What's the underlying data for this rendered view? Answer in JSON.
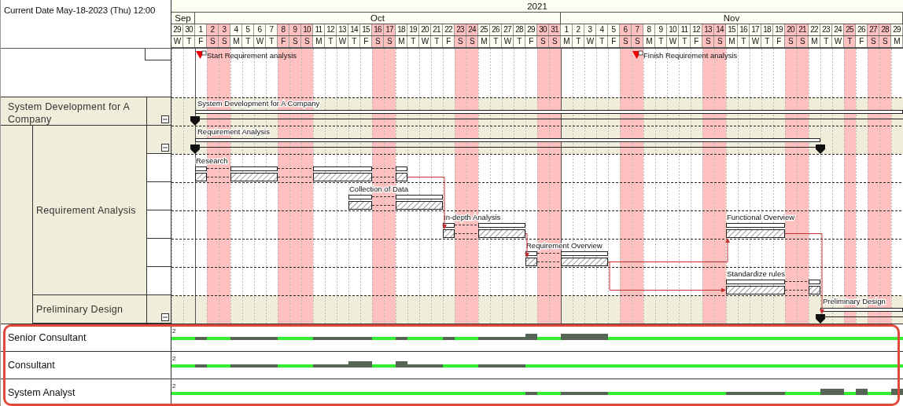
{
  "header": {
    "current_date": "Current Date May-18-2023 (Thu) 12:00"
  },
  "timeline": {
    "year": "2021",
    "months": [
      {
        "label": "Sep",
        "days": [
          {
            "date": "29",
            "weekday": "W",
            "holiday": false
          },
          {
            "date": "30",
            "weekday": "T",
            "holiday": false
          }
        ]
      },
      {
        "label": "Oct",
        "days": [
          {
            "date": "1",
            "weekday": "F",
            "holiday": false
          },
          {
            "date": "2",
            "weekday": "S",
            "holiday": true
          },
          {
            "date": "3",
            "weekday": "S",
            "holiday": true
          },
          {
            "date": "4",
            "weekday": "M",
            "holiday": false
          },
          {
            "date": "5",
            "weekday": "T",
            "holiday": false
          },
          {
            "date": "6",
            "weekday": "W",
            "holiday": false
          },
          {
            "date": "7",
            "weekday": "T",
            "holiday": false
          },
          {
            "date": "8",
            "weekday": "F",
            "holiday": true
          },
          {
            "date": "9",
            "weekday": "S",
            "holiday": true
          },
          {
            "date": "10",
            "weekday": "S",
            "holiday": true
          },
          {
            "date": "11",
            "weekday": "M",
            "holiday": false
          },
          {
            "date": "12",
            "weekday": "T",
            "holiday": false
          },
          {
            "date": "13",
            "weekday": "W",
            "holiday": false
          },
          {
            "date": "14",
            "weekday": "T",
            "holiday": false
          },
          {
            "date": "15",
            "weekday": "F",
            "holiday": false
          },
          {
            "date": "16",
            "weekday": "S",
            "holiday": true
          },
          {
            "date": "17",
            "weekday": "S",
            "holiday": true
          },
          {
            "date": "18",
            "weekday": "M",
            "holiday": false
          },
          {
            "date": "19",
            "weekday": "T",
            "holiday": false
          },
          {
            "date": "20",
            "weekday": "W",
            "holiday": false
          },
          {
            "date": "21",
            "weekday": "T",
            "holiday": false
          },
          {
            "date": "22",
            "weekday": "F",
            "holiday": false
          },
          {
            "date": "23",
            "weekday": "S",
            "holiday": true
          },
          {
            "date": "24",
            "weekday": "S",
            "holiday": true
          },
          {
            "date": "25",
            "weekday": "M",
            "holiday": false
          },
          {
            "date": "26",
            "weekday": "T",
            "holiday": false
          },
          {
            "date": "27",
            "weekday": "W",
            "holiday": false
          },
          {
            "date": "28",
            "weekday": "T",
            "holiday": false
          },
          {
            "date": "29",
            "weekday": "F",
            "holiday": false
          },
          {
            "date": "30",
            "weekday": "S",
            "holiday": true
          },
          {
            "date": "31",
            "weekday": "S",
            "holiday": true
          }
        ]
      },
      {
        "label": "Nov",
        "days": [
          {
            "date": "1",
            "weekday": "M",
            "holiday": false
          },
          {
            "date": "2",
            "weekday": "T",
            "holiday": false
          },
          {
            "date": "3",
            "weekday": "W",
            "holiday": false
          },
          {
            "date": "4",
            "weekday": "T",
            "holiday": false
          },
          {
            "date": "5",
            "weekday": "F",
            "holiday": false
          },
          {
            "date": "6",
            "weekday": "S",
            "holiday": true
          },
          {
            "date": "7",
            "weekday": "S",
            "holiday": true
          },
          {
            "date": "8",
            "weekday": "M",
            "holiday": false
          },
          {
            "date": "9",
            "weekday": "T",
            "holiday": false
          },
          {
            "date": "10",
            "weekday": "W",
            "holiday": false
          },
          {
            "date": "11",
            "weekday": "T",
            "holiday": false
          },
          {
            "date": "12",
            "weekday": "F",
            "holiday": false
          },
          {
            "date": "13",
            "weekday": "S",
            "holiday": true
          },
          {
            "date": "14",
            "weekday": "S",
            "holiday": true
          },
          {
            "date": "15",
            "weekday": "M",
            "holiday": false
          },
          {
            "date": "16",
            "weekday": "T",
            "holiday": false
          },
          {
            "date": "17",
            "weekday": "W",
            "holiday": false
          },
          {
            "date": "18",
            "weekday": "T",
            "holiday": false
          },
          {
            "date": "19",
            "weekday": "F",
            "holiday": false
          },
          {
            "date": "20",
            "weekday": "S",
            "holiday": true
          },
          {
            "date": "21",
            "weekday": "S",
            "holiday": true
          },
          {
            "date": "22",
            "weekday": "M",
            "holiday": false
          },
          {
            "date": "23",
            "weekday": "T",
            "holiday": false
          },
          {
            "date": "24",
            "weekday": "W",
            "holiday": false
          },
          {
            "date": "25",
            "weekday": "T",
            "holiday": true
          },
          {
            "date": "26",
            "weekday": "F",
            "holiday": false
          },
          {
            "date": "27",
            "weekday": "S",
            "holiday": true
          },
          {
            "date": "28",
            "weekday": "S",
            "holiday": true
          },
          {
            "date": "29",
            "weekday": "M",
            "holiday": false
          }
        ]
      }
    ]
  },
  "milestones": [
    {
      "label": "Start Requirement analysis"
    },
    {
      "label": "Finish Requirement analysis"
    }
  ],
  "outline": [
    {
      "label": "System Development for A Company",
      "expanded": true,
      "children": [
        {
          "label": "Requirement Analysis",
          "expanded": true
        },
        {
          "label": "Preliminary Design",
          "expanded": true
        }
      ]
    }
  ],
  "gantt_rows": [
    {
      "kind": "summary",
      "bars": [
        {
          "label": "System Development for A Company",
          "end_marker": false
        }
      ]
    },
    {
      "kind": "summary",
      "bars": [
        {
          "label": "Requirement Analysis",
          "end_marker": true
        }
      ]
    },
    {
      "kind": "task",
      "bars": [
        {
          "label": "Research"
        }
      ]
    },
    {
      "kind": "task",
      "bars": [
        {
          "label": "Collection of Data"
        }
      ]
    },
    {
      "kind": "task",
      "bars": [
        {
          "label": "In-depth Analysis"
        },
        {
          "label": "Functional Overview"
        }
      ]
    },
    {
      "kind": "task",
      "bars": [
        {
          "label": "Requirement Overview"
        }
      ]
    },
    {
      "kind": "task",
      "bars": [
        {
          "label": "Standardize rules"
        }
      ]
    },
    {
      "kind": "summary",
      "bars": [
        {
          "label": "Preliminary Design",
          "end_marker": false
        }
      ]
    }
  ],
  "resources": [
    {
      "name": "Senior Consultant",
      "scale_label": "2"
    },
    {
      "name": "Consultant",
      "scale_label": "2"
    },
    {
      "name": "System Analyst",
      "scale_label": "2"
    }
  ]
}
